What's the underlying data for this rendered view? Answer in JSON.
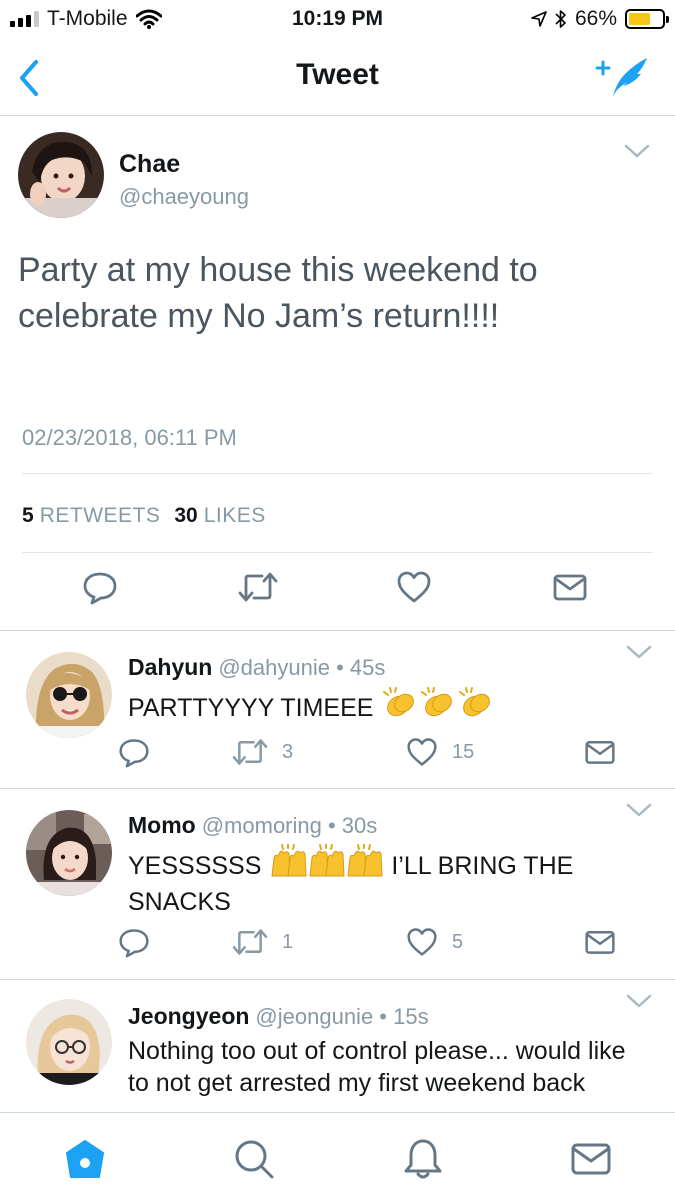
{
  "status_bar": {
    "carrier": "T-Mobile",
    "time": "10:19 PM",
    "battery_percent": "66%",
    "battery_level": 0.66
  },
  "nav": {
    "title": "Tweet"
  },
  "main_tweet": {
    "name": "Chae",
    "handle": "@chaeyoung",
    "text": "Party at my house this weekend to celebrate my No Jam’s return!!!!",
    "timestamp": "02/23/2018, 06:11 PM",
    "retweets_count": "5",
    "retweets_label": "RETWEETS",
    "likes_count": "30",
    "likes_label": "LIKES"
  },
  "replies": [
    {
      "name": "Dahyun",
      "meta": "@dahyunie • 45s",
      "text": "PARTTYYYY TIMEEE",
      "retweets": "3",
      "likes": "15"
    },
    {
      "name": "Momo",
      "meta": "@momoring • 30s",
      "text_before": "YESSSSSS",
      "text_after": "I’LL BRING THE SNACKS",
      "retweets": "1",
      "likes": "5"
    },
    {
      "name": "Jeongyeon",
      "meta": "@jeongunie • 15s",
      "text": "Nothing too out of control please... would like to not get arrested my first weekend back"
    }
  ],
  "colors": {
    "accent": "#1da1f2",
    "muted": "#8899a6",
    "divider": "#ccd6dd",
    "battery": "#f5c518"
  }
}
